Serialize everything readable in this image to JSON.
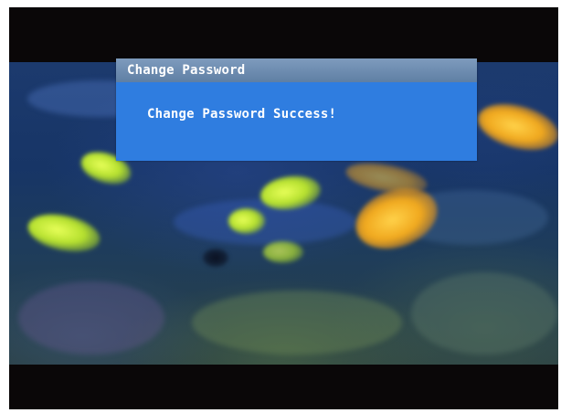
{
  "dialog": {
    "title": "Change Password",
    "message": "Change Password Success!"
  },
  "colors": {
    "dialog_title_bar": "#6f8db2",
    "dialog_body": "#2f7de0",
    "letterbox": "#0a0708",
    "text": "#ffffff"
  }
}
